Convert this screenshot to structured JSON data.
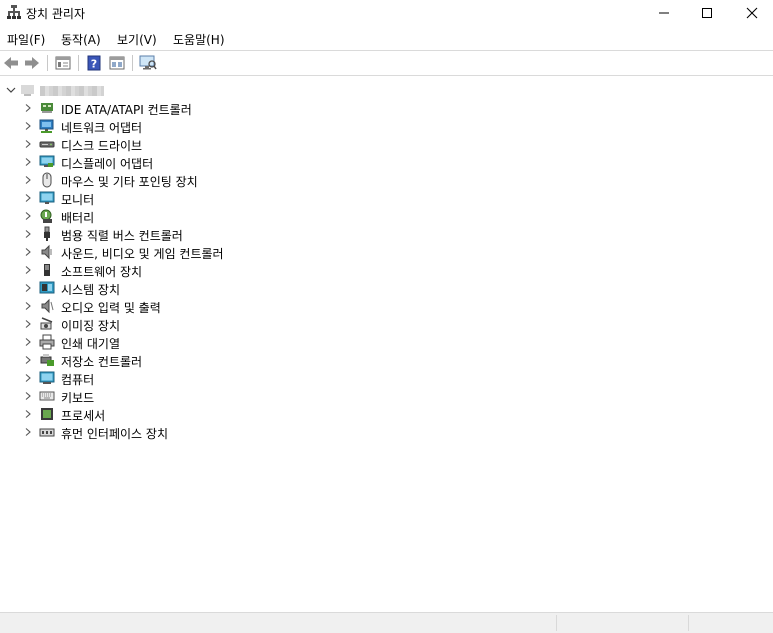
{
  "window": {
    "title": "장치 관리자",
    "controls": [
      "minimize",
      "maximize",
      "close"
    ]
  },
  "menu": {
    "items": [
      {
        "label": "파일(F)"
      },
      {
        "label": "동작(A)"
      },
      {
        "label": "보기(V)"
      },
      {
        "label": "도움말(H)"
      }
    ]
  },
  "toolbar": {
    "buttons": [
      "back-icon",
      "forward-icon",
      "properties-icon",
      "help-icon",
      "view-icon",
      "monitor-icon"
    ]
  },
  "tree": {
    "root_expanded": true,
    "nodes": [
      {
        "label": "IDE ATA/ATAPI 컨트롤러",
        "icon": "ide-controller-icon"
      },
      {
        "label": "네트워크 어댑터",
        "icon": "network-adapter-icon"
      },
      {
        "label": "디스크 드라이브",
        "icon": "disk-drive-icon"
      },
      {
        "label": "디스플레이 어댑터",
        "icon": "display-adapter-icon"
      },
      {
        "label": "마우스 및 기타 포인팅 장치",
        "icon": "mouse-icon"
      },
      {
        "label": "모니터",
        "icon": "monitor-icon"
      },
      {
        "label": "배터리",
        "icon": "battery-icon"
      },
      {
        "label": "범용 직렬 버스 컨트롤러",
        "icon": "usb-icon"
      },
      {
        "label": "사운드, 비디오 및 게임 컨트롤러",
        "icon": "speaker-icon"
      },
      {
        "label": "소프트웨어 장치",
        "icon": "software-device-icon"
      },
      {
        "label": "시스템 장치",
        "icon": "system-device-icon"
      },
      {
        "label": "오디오 입력 및 출력",
        "icon": "audio-io-icon"
      },
      {
        "label": "이미징 장치",
        "icon": "camera-icon"
      },
      {
        "label": "인쇄 대기열",
        "icon": "printer-icon"
      },
      {
        "label": "저장소 컨트롤러",
        "icon": "storage-controller-icon"
      },
      {
        "label": "컴퓨터",
        "icon": "computer-icon"
      },
      {
        "label": "키보드",
        "icon": "keyboard-icon"
      },
      {
        "label": "프로세서",
        "icon": "processor-icon"
      },
      {
        "label": "휴먼 인터페이스 장치",
        "icon": "hid-icon"
      }
    ]
  }
}
